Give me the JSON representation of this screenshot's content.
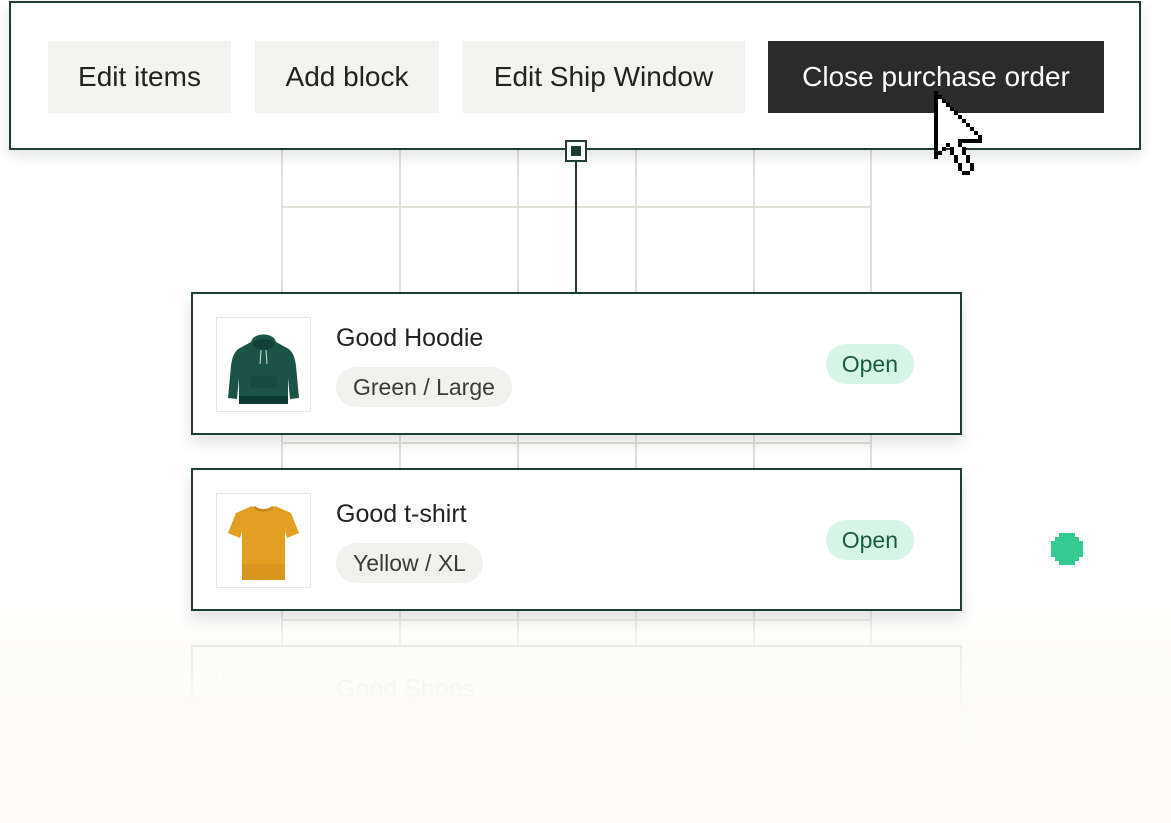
{
  "toolbar": {
    "buttons": [
      {
        "label": "Edit items"
      },
      {
        "label": "Add block"
      },
      {
        "label": "Edit Ship Window"
      },
      {
        "label": "Close purchase order"
      }
    ]
  },
  "items": [
    {
      "name": "Good Hoodie",
      "variant": "Green / Large",
      "status": "Open",
      "image": "green-hoodie"
    },
    {
      "name": "Good t-shirt",
      "variant": "Yellow / XL",
      "status": "Open",
      "image": "yellow-tshirt"
    },
    {
      "name": "Good Shoes"
    }
  ],
  "colors": {
    "border": "#1e3d33",
    "primary_button": "#2b2b2b",
    "status_badge_bg": "#d6f5e6",
    "status_badge_text": "#1a5c3c",
    "hoodie": "#1b5447",
    "tshirt": "#e39f21",
    "accent_dot": "#34c98e"
  },
  "icons": {
    "cursor": "pointer-cursor-icon",
    "anchor": "connector-handle-icon",
    "dot": "pixel-dot-icon"
  }
}
